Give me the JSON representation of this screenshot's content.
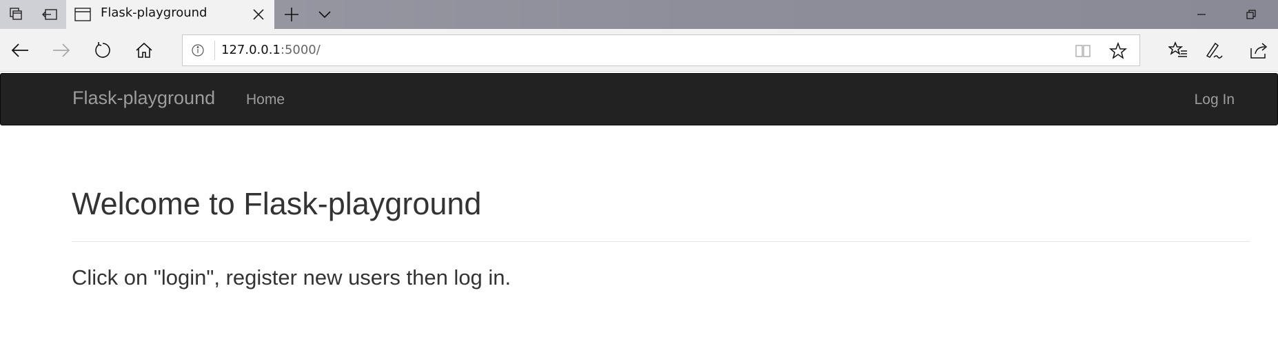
{
  "browser": {
    "tab": {
      "title": "Flask-playground"
    },
    "address": {
      "host": "127.0.0.1",
      "port_path": ":5000/"
    }
  },
  "site": {
    "brand": "Flask-playground",
    "nav": {
      "home": "Home",
      "login": "Log In"
    }
  },
  "main": {
    "heading": "Welcome to Flask-playground",
    "lead": "Click on \"login\", register new users then log in."
  },
  "colors": {
    "navbar_bg": "#222222",
    "nav_text": "#9d9d9d",
    "body_text": "#333333"
  }
}
